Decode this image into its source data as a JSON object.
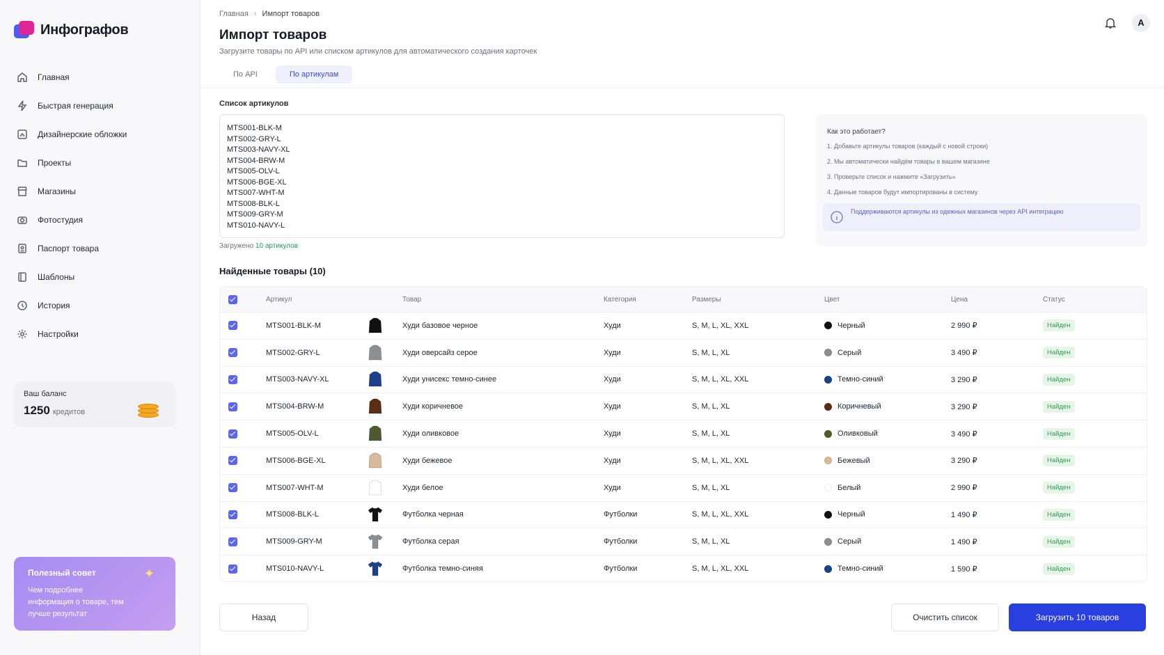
{
  "app": {
    "name": "Инфографов"
  },
  "sidebar": {
    "items": [
      {
        "label": "Главная",
        "icon": "home-icon"
      },
      {
        "label": "Быстрая генерация",
        "icon": "lightning-icon"
      },
      {
        "label": "Дизайнерские обложки",
        "icon": "image-edit-icon"
      },
      {
        "label": "Проекты",
        "icon": "folder-icon"
      },
      {
        "label": "Магазины",
        "icon": "store-icon"
      },
      {
        "label": "Фотостудия",
        "icon": "camera-icon"
      },
      {
        "label": "Паспорт товара",
        "icon": "id-card-icon"
      },
      {
        "label": "Шаблоны",
        "icon": "template-icon"
      },
      {
        "label": "История",
        "icon": "history-icon"
      },
      {
        "label": "Настройки",
        "icon": "gear-icon"
      }
    ],
    "balance": {
      "label": "Ваш баланс",
      "value": "1250",
      "unit": "кредитов"
    },
    "tip": {
      "title": "Полезный совет",
      "text": "Чем подробнее информация о товаре, тем лучше результат"
    }
  },
  "header": {
    "breadcrumbs": [
      "Главная",
      "Импорт товаров"
    ],
    "title": "Импорт товаров",
    "subtitle": "Загрузите товары по API или списком артикулов для автоматического создания карточек",
    "tabs": [
      {
        "label": "По API",
        "active": false
      },
      {
        "label": "По артикулам",
        "active": true
      }
    ],
    "avatar": "A"
  },
  "sku_input": {
    "label": "Список артикулов",
    "value": "MTS001-BLK-M\nMTS002-GRY-L\nMTS003-NAVY-XL\nMTS004-BRW-M\nMTS005-OLV-L\nMTS006-BGE-XL\nMTS007-WHT-M\nMTS008-BLK-L\nMTS009-GRY-M\nMTS010-NAVY-L",
    "loaded_prefix": "Загружено",
    "loaded_count": "10 артикулов"
  },
  "help": {
    "title": "Как это работает?",
    "steps": [
      "1. Добавьте артикулы товаров (каждый с новой строки)",
      "2. Мы автоматически найдём товары в вашем магазине",
      "3. Проверьте список и нажмите «Загрузить»",
      "4. Данные товаров будут импортированы в систему"
    ],
    "note": "Поддерживаются артикулы из одежных магазинов через API интеграцию"
  },
  "table": {
    "title": "Найденные товары (10)",
    "columns": [
      "Артикул",
      "Товар",
      "Категория",
      "Размеры",
      "Цвет",
      "Цена",
      "Статус"
    ],
    "rows": [
      {
        "sku": "MTS001-BLK-M",
        "name": "Худи базовое черное",
        "category": "Худи",
        "sizes": "S, M, L, XL, XXL",
        "color": "Черный",
        "swatch": "#111111",
        "price": "2 990 ₽",
        "status": "Найден",
        "kind": "hoodie"
      },
      {
        "sku": "MTS002-GRY-L",
        "name": "Худи оверсайз серое",
        "category": "Худи",
        "sizes": "S, M, L, XL",
        "color": "Серый",
        "swatch": "#8d8f94",
        "price": "3 490 ₽",
        "status": "Найден",
        "kind": "hoodie"
      },
      {
        "sku": "MTS003-NAVY-XL",
        "name": "Худи унисекс темно-синее",
        "category": "Худи",
        "sizes": "S, M, L, XL, XXL",
        "color": "Темно-синий",
        "swatch": "#1e3f8a",
        "price": "3 290 ₽",
        "status": "Найден",
        "kind": "hoodie"
      },
      {
        "sku": "MTS004-BRW-M",
        "name": "Худи коричневое",
        "category": "Худи",
        "sizes": "S, M, L, XL",
        "color": "Коричневый",
        "swatch": "#5a2d14",
        "price": "3 290 ₽",
        "status": "Найден",
        "kind": "hoodie"
      },
      {
        "sku": "MTS005-OLV-L",
        "name": "Худи оливковое",
        "category": "Худи",
        "sizes": "S, M, L, XL",
        "color": "Оливковый",
        "swatch": "#4f5a32",
        "price": "3 490 ₽",
        "status": "Найден",
        "kind": "hoodie"
      },
      {
        "sku": "MTS006-BGE-XL",
        "name": "Худи бежевое",
        "category": "Худи",
        "sizes": "S, M, L, XL, XXL",
        "color": "Бежевый",
        "swatch": "#d8b99a",
        "price": "3 290 ₽",
        "status": "Найден",
        "kind": "hoodie"
      },
      {
        "sku": "MTS007-WHT-M",
        "name": "Худи белое",
        "category": "Худи",
        "sizes": "S, M, L, XL",
        "color": "Белый",
        "swatch": "#ffffff",
        "price": "2 990 ₽",
        "status": "Найден",
        "kind": "hoodie"
      },
      {
        "sku": "MTS008-BLK-L",
        "name": "Футболка черная",
        "category": "Футболки",
        "sizes": "S, M, L, XL, XXL",
        "color": "Черный",
        "swatch": "#111111",
        "price": "1 490 ₽",
        "status": "Найден",
        "kind": "tshirt"
      },
      {
        "sku": "MTS009-GRY-M",
        "name": "Футболка серая",
        "category": "Футболки",
        "sizes": "S, M, L, XL",
        "color": "Серый",
        "swatch": "#8d8f94",
        "price": "1 490 ₽",
        "status": "Найден",
        "kind": "tshirt"
      },
      {
        "sku": "MTS010-NAVY-L",
        "name": "Футболка темно-синяя",
        "category": "Футболки",
        "sizes": "S, M, L, XL, XXL",
        "color": "Темно-синий",
        "swatch": "#1e3f8a",
        "price": "1 590 ₽",
        "status": "Найден",
        "kind": "tshirt"
      }
    ]
  },
  "actions": {
    "back": "Назад",
    "clear": "Очистить список",
    "load": "Загрузить 10 товаров"
  },
  "colors": {
    "accent": "#2a3fe0",
    "checkbox": "#5b67e6",
    "success": "#2e9e4f"
  }
}
